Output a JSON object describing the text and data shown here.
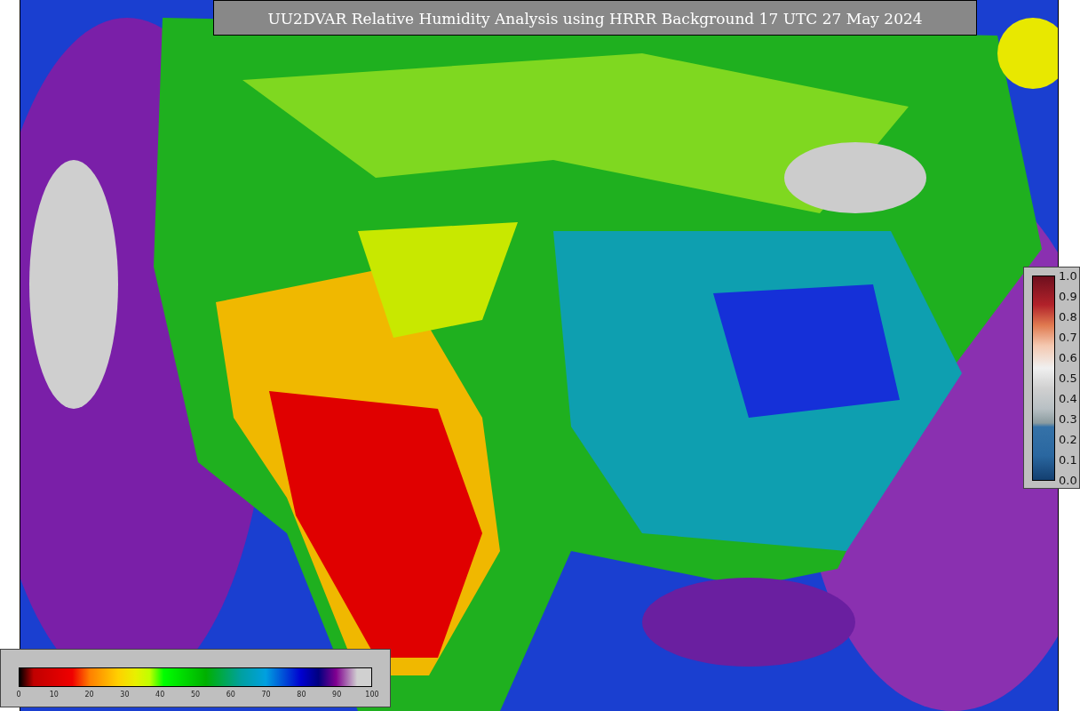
{
  "title": "UU2DVAR Relative Humidity Analysis using HRRR Background 17 UTC 27 May 2024",
  "observation_legend": {
    "ticks": [
      "1.0",
      "0.9",
      "0.8",
      "0.7",
      "0.6",
      "0.5",
      "0.4",
      "0.3",
      "0.2",
      "0.1",
      "0.0"
    ]
  },
  "humidity_legend": {
    "ticks": [
      "0",
      "10",
      "20",
      "30",
      "40",
      "50",
      "60",
      "70",
      "80",
      "90",
      "100"
    ]
  }
}
